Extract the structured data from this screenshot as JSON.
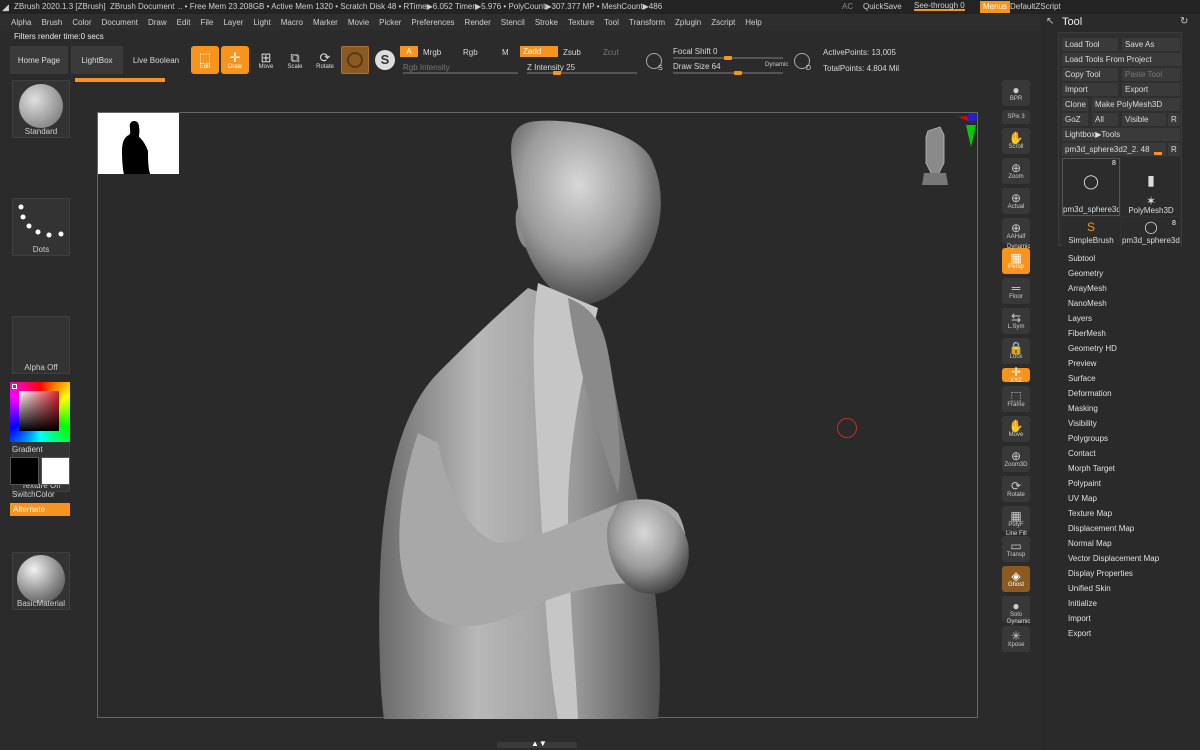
{
  "titlebar": {
    "app": "ZBrush 2020.1.3 [ZBrush]",
    "doc": "ZBrush Document",
    "stats": ".. • Free Mem 23.208GB • Active Mem 1320 • Scratch Disk 48 • RTime▶6.052 Timer▶5.976 • PolyCount▶307.377 MP • MeshCount▶486",
    "ac": "AC",
    "quicksave": "QuickSave",
    "seethrough": "See-through  0",
    "menus": "Menus",
    "script": "DefaultZScript"
  },
  "menus": [
    "Alpha",
    "Brush",
    "Color",
    "Document",
    "Draw",
    "Edit",
    "File",
    "Layer",
    "Light",
    "Macro",
    "Marker",
    "Movie",
    "Picker",
    "Preferences",
    "Render",
    "Stencil",
    "Stroke",
    "Texture",
    "Tool",
    "Transform",
    "Zplugin",
    "Zscript",
    "Help"
  ],
  "status": "Filters render time:0 secs",
  "toolbar": {
    "home": "Home Page",
    "lightbox": "LightBox",
    "liveboolean": "Live Boolean",
    "edit": "Edit",
    "draw": "Draw",
    "move": "Move",
    "scale": "Scale",
    "rotate": "Rotate",
    "a": "A",
    "mrgb": "Mrgb",
    "rgb": "Rgb",
    "m": "M",
    "zadd": "Zadd",
    "zsub": "Zsub",
    "zcut": "Zcut",
    "rgbintensity": "Rgb Intensity",
    "zintensity": "Z Intensity 25",
    "zintensity_value": 0.25,
    "focalshift": "Focal Shift 0",
    "focalshift_value": 0.5,
    "drawsize": "Draw Size 64",
    "drawsize_value": 0.6,
    "dynamic": "Dynamic",
    "s": "S",
    "d": "D",
    "activepoints": "ActivePoints: 13,005",
    "totalpoints": "TotalPoints: 4.804 Mil"
  },
  "left": {
    "standard": "Standard",
    "dots": "Dots",
    "alphaoff": "Alpha Off",
    "textureoff": "Texture Off",
    "material": "BasicMaterial",
    "gradient": "Gradient",
    "switchcolor": "SwitchColor",
    "alternate": "Alternate"
  },
  "shelf": [
    "BPR",
    "SPix 3",
    "Scroll",
    "Zoom",
    "Actual",
    "AAHalf",
    "Persp",
    "Floor",
    "L.Sym",
    "Lock",
    "XYZ",
    "Frame",
    "Move",
    "Zoom3D",
    "Rotate",
    "PolyF",
    "Transp",
    "Ghost",
    "Solo",
    "Xpose"
  ],
  "shelf_extra": {
    "dynamic": "Dynamic",
    "linefill": "Line Fill",
    "dynamic2": "Dynamic"
  },
  "tool": {
    "title": "Tool",
    "buttons": [
      "Load Tool",
      "Save As",
      "Load Tools From Project",
      "Copy Tool",
      "Paste Tool",
      "Import",
      "Export",
      "Clone",
      "Make PolyMesh3D",
      "GoZ",
      "All",
      "Visible",
      "R",
      "Lightbox▶Tools",
      "pm3d_sphere3d2_2. 48",
      "R"
    ],
    "subtools": [
      "pm3d_sphere3d.",
      "Cylinder3D",
      "PolyMesh3D",
      "SimpleBrush",
      "pm3d_sphere3d."
    ],
    "badges": [
      "8",
      "8"
    ],
    "items": [
      "Subtool",
      "Geometry",
      "ArrayMesh",
      "NanoMesh",
      "Layers",
      "FiberMesh",
      "Geometry HD",
      "Preview",
      "Surface",
      "Deformation",
      "Masking",
      "Visibility",
      "Polygroups",
      "Contact",
      "Morph Target",
      "Polypaint",
      "UV Map",
      "Texture Map",
      "Displacement Map",
      "Normal Map",
      "Vector Displacement Map",
      "Display Properties",
      "Unified Skin",
      "Initialize",
      "Import",
      "Export"
    ]
  },
  "colors": {
    "accent": "#f7941d",
    "bg": "#2b2b2b",
    "panel": "#3a3a3a"
  }
}
